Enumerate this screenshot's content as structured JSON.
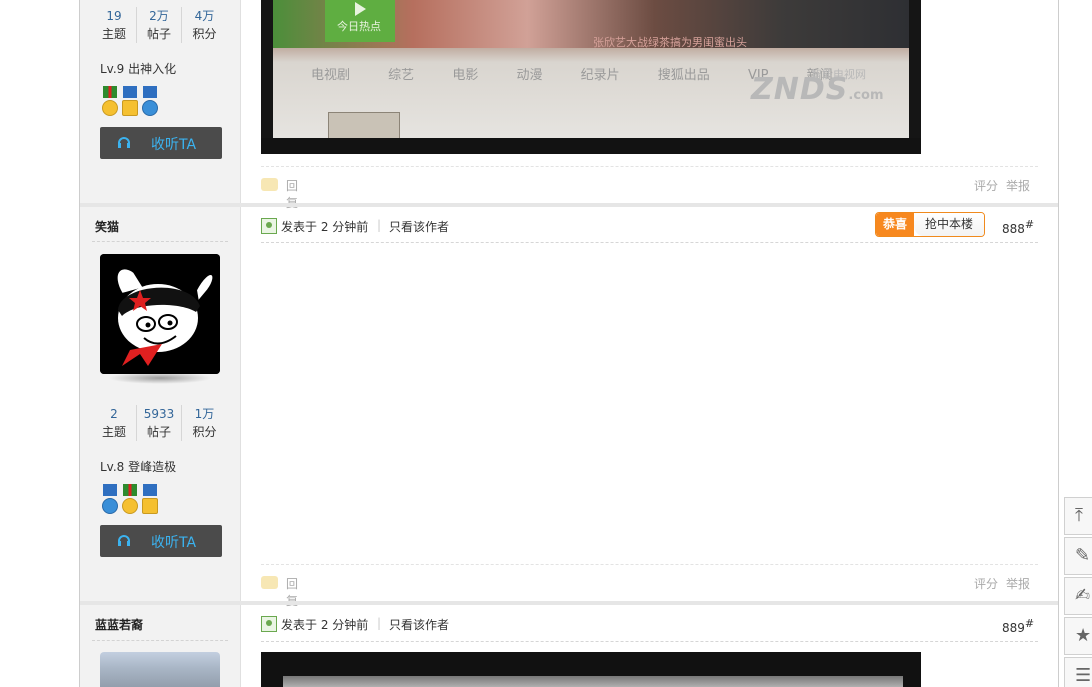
{
  "top_post": {
    "image": {
      "banner_play_label": "今日热点",
      "banner_caption": "张欣艺大战绿茶搞为男闺蜜出头",
      "nav_items": [
        "电视剧",
        "综艺",
        "电影",
        "动漫",
        "纪录片",
        "搜狐出品",
        "VIP",
        "新闻"
      ],
      "logo_text": "ZNDS",
      "logo_suffix": ".com",
      "logo_subtitle": "智能电视网"
    },
    "footer": {
      "reply": "回复",
      "rate": "评分",
      "report": "举报"
    }
  },
  "users": [
    {
      "stats": [
        {
          "num": "19",
          "label": "主题"
        },
        {
          "num": "2万",
          "label": "帖子"
        },
        {
          "num": "4万",
          "label": "积分"
        }
      ],
      "level": "Lv.9 出神入化",
      "listen_label": "收听TA"
    },
    {
      "name": "笑猫",
      "stats": [
        {
          "num": "2",
          "label": "主题"
        },
        {
          "num": "5933",
          "label": "帖子"
        },
        {
          "num": "1万",
          "label": "积分"
        }
      ],
      "level": "Lv.8 登峰造极",
      "listen_label": "收听TA"
    },
    {
      "name": "蓝蓝若裔"
    }
  ],
  "posts": [
    {
      "time": "发表于 2 分钟前",
      "separator": "|",
      "author_only": "只看该作者",
      "badge_left": "恭喜",
      "badge_right": "抢中本楼",
      "floor": "888",
      "floor_mark": "#",
      "footer": {
        "reply": "回复",
        "rate": "评分",
        "report": "举报"
      }
    },
    {
      "time": "发表于 2 分钟前",
      "separator": "|",
      "author_only": "只看该作者",
      "floor": "889",
      "floor_mark": "#"
    }
  ],
  "right_toolbar": [
    {
      "icon": "back-to-top-icon"
    },
    {
      "icon": "edit-icon"
    },
    {
      "icon": "reply-icon"
    },
    {
      "icon": "star-icon"
    },
    {
      "icon": "list-icon"
    }
  ],
  "colors": {
    "link_blue": "#336699",
    "listen_button_bg": "#4b4b4b",
    "listen_text": "#3bb3f0",
    "badge_orange": "#f7881f"
  }
}
